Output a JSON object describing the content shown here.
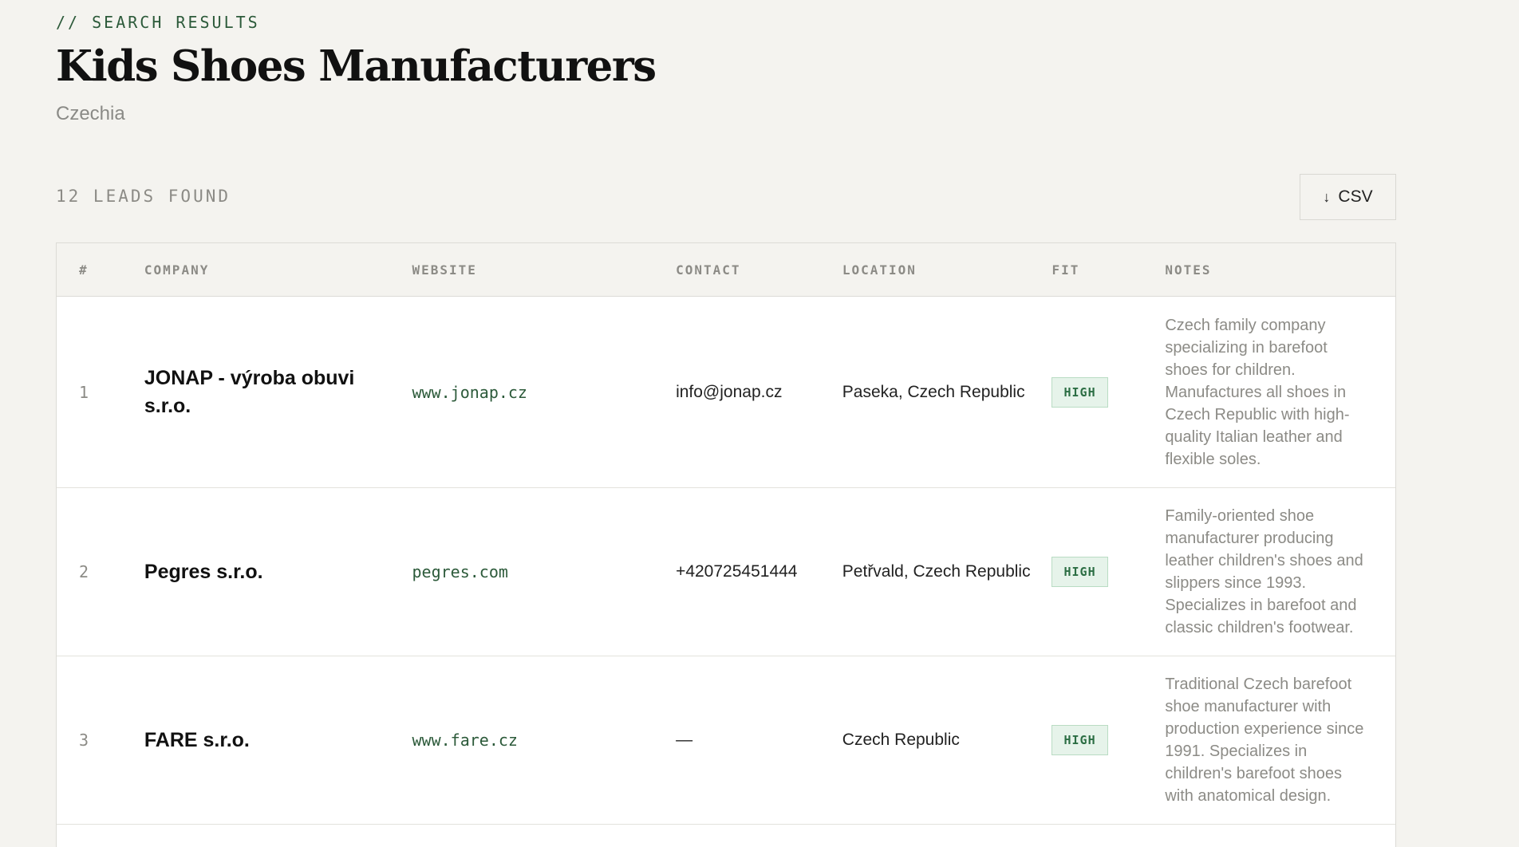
{
  "header": {
    "eyebrow": "// SEARCH RESULTS",
    "title": "Kids Shoes Manufacturers",
    "subtitle": "Czechia"
  },
  "toolbar": {
    "count_label": "12 LEADS FOUND",
    "csv_icon": "download-arrow-icon",
    "csv_label": "CSV"
  },
  "table": {
    "columns": [
      "#",
      "COMPANY",
      "WEBSITE",
      "CONTACT",
      "LOCATION",
      "FIT",
      "NOTES"
    ],
    "rows": [
      {
        "num": "1",
        "company": "JONAP - výroba obuvi s.r.o.",
        "website": "www.jonap.cz",
        "contact": "info@jonap.cz",
        "location": "Paseka, Czech Republic",
        "fit": "HIGH",
        "notes": "Czech family company specializing in barefoot shoes for children. Manufactures all shoes in Czech Republic with high-quality Italian leather and flexible soles."
      },
      {
        "num": "2",
        "company": "Pegres s.r.o.",
        "website": "pegres.com",
        "contact": "+420725451444",
        "location": "Petřvald, Czech Republic",
        "fit": "HIGH",
        "notes": "Family-oriented shoe manufacturer producing leather children's shoes and slippers since 1993. Specializes in barefoot and classic children's footwear."
      },
      {
        "num": "3",
        "company": "FARE s.r.o.",
        "website": "www.fare.cz",
        "contact": "—",
        "location": "Czech Republic",
        "fit": "HIGH",
        "notes": "Traditional Czech barefoot shoe manufacturer with production experience since 1991. Specializes in children's barefoot shoes with anatomical design."
      }
    ]
  },
  "colors": {
    "background": "#f4f3ef",
    "accent_green": "#2c5a3a",
    "badge_bg": "#e6f3ea",
    "muted": "#8c8b86"
  }
}
